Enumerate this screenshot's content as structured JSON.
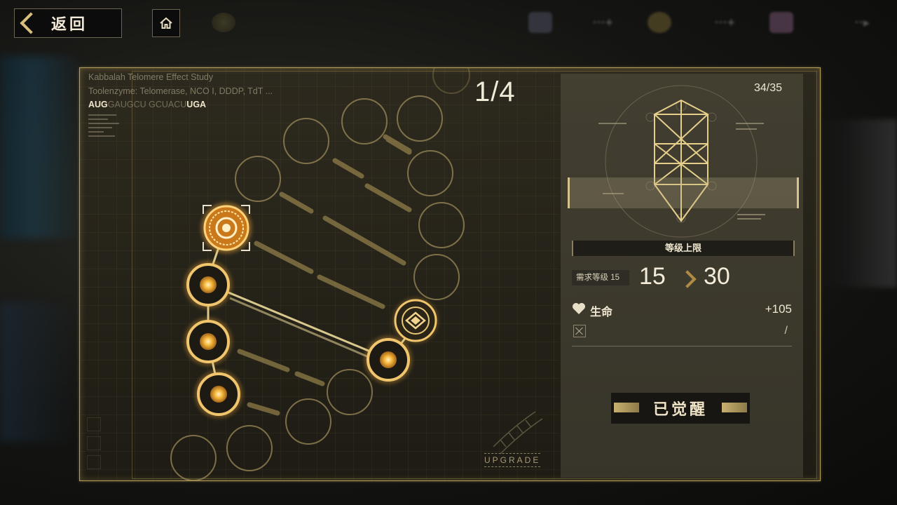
{
  "header": {
    "back_label": "返回",
    "home_icon": "home-icon"
  },
  "study": {
    "title": "Kabbalah Telomere Effect Study",
    "enzyme_line": "Toolenzyme: Telomerase, NCO I, DDDP, TdT ...",
    "rna_start": "AUG",
    "rna_mid": "GAUGCU GCUACU",
    "rna_end": "UGA"
  },
  "page_counter": "1/4",
  "upgrade_label": "UPGRADE",
  "info": {
    "progress": "34/35",
    "section_title": "等级上限",
    "required_level_label": "需求等级 15",
    "level_from": "15",
    "level_to": "30",
    "stat_name": "生命",
    "stat_value": "+105",
    "second_stat_value": "/",
    "button_label": "已觉醒"
  },
  "colors": {
    "accent_gold": "#d8c07c",
    "node_glow": "#f4b23c",
    "panel_border": "#b59d5a"
  }
}
